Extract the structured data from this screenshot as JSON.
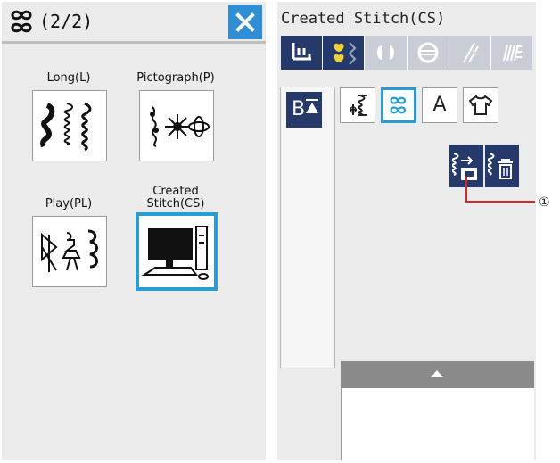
{
  "left_panel": {
    "header": {
      "icon": "pattern-icon",
      "page_indicator": "(2/2)"
    },
    "close_icon": "close-icon",
    "categories": [
      {
        "label": "Long(L)",
        "icon": "long-stitches-icon"
      },
      {
        "label": "Pictograph(P)",
        "icon": "pictograph-stitches-icon"
      },
      {
        "label": "Play(PL)",
        "icon": "play-stitches-icon"
      },
      {
        "label": "Created Stitch(CS)",
        "label_line1": "Created",
        "label_line2": "Stitch(CS)",
        "icon": "computer-icon",
        "selected": true
      }
    ]
  },
  "right_panel": {
    "title": "Created Stitch(CS)",
    "mode_tabs": [
      {
        "icon": "sewing-foot-icon",
        "state": "normal"
      },
      {
        "icon": "heart-stitch-icon",
        "state": "active"
      },
      {
        "icon": "buttonhole-icon",
        "state": "dim"
      },
      {
        "icon": "satin-stitch-icon",
        "state": "dim"
      },
      {
        "icon": "needle-icon",
        "state": "dim"
      },
      {
        "icon": "stretch-stitch-icon",
        "state": "dim"
      }
    ],
    "sort_button": {
      "label": "B"
    },
    "type_buttons": [
      {
        "icon": "utility-stitch-icon",
        "active": false
      },
      {
        "icon": "decorative-stitch-icon",
        "active": true
      },
      {
        "label": "A",
        "active": false
      },
      {
        "icon": "shirt-icon",
        "active": false
      }
    ],
    "actions": [
      {
        "icon": "load-stitch-icon"
      },
      {
        "icon": "delete-stitch-icon"
      }
    ],
    "callout_number": "①"
  },
  "colors": {
    "navy": "#253a6b",
    "accent_blue": "#2a9cd4",
    "panel_bg": "#ebebeb",
    "callout_red": "#d9252a"
  }
}
